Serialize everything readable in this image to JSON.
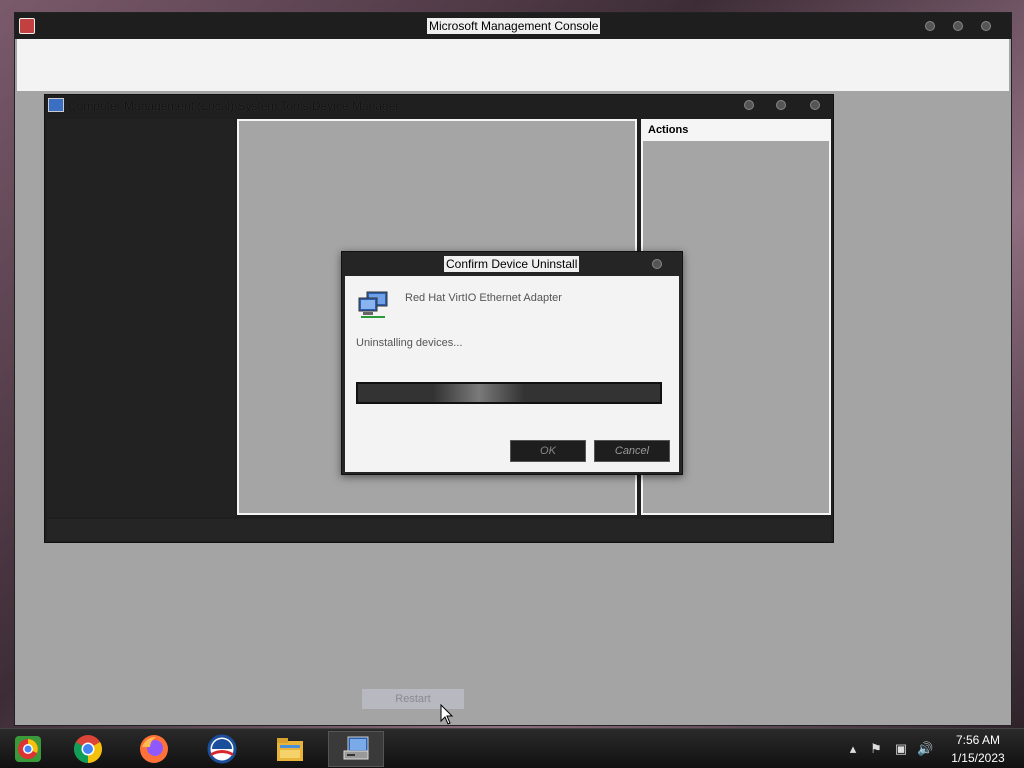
{
  "mmc": {
    "title": "Microsoft Management Console"
  },
  "device_manager": {
    "title": "Computer Management (Local)\\System Tools\\Device Manager",
    "actions_header": "Actions"
  },
  "dialog": {
    "title": "Confirm Device Uninstall",
    "device_name": "Red Hat VirtIO Ethernet Adapter",
    "status": "Uninstalling devices...",
    "ok_label": "OK",
    "cancel_label": "Cancel"
  },
  "restart_label": "Restart",
  "taskbar": {
    "apps": [
      {
        "icon": "chrome-alt-icon"
      },
      {
        "icon": "chrome-icon"
      },
      {
        "icon": "firefox-icon"
      },
      {
        "icon": "obama-logo-icon"
      },
      {
        "icon": "file-explorer-icon"
      },
      {
        "icon": "device-manager-icon"
      }
    ],
    "time": "7:56 AM",
    "date": "1/15/2023"
  }
}
